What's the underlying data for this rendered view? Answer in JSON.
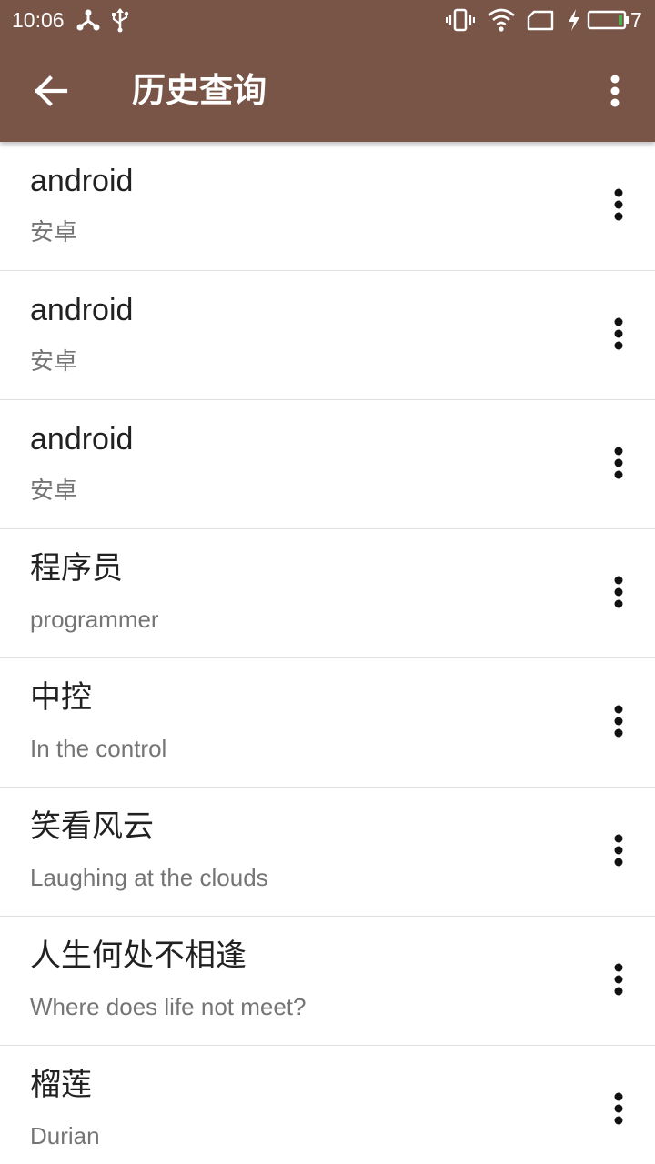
{
  "status_bar": {
    "time": "10:06",
    "battery_level": "7",
    "icons": [
      "share-network-icon",
      "usb-icon",
      "vibrate-icon",
      "wifi-icon",
      "sim-card-icon",
      "charging-bolt-icon",
      "battery-icon"
    ]
  },
  "toolbar": {
    "title": "历史查询",
    "back_icon": "arrow-back-icon",
    "menu_icon": "more-vert-icon"
  },
  "colors": {
    "app_bar": "#795548",
    "primary_text": "#212121",
    "secondary_text": "#757575",
    "divider": "#e0e0e0",
    "battery_fill": "#4caf50"
  },
  "history": [
    {
      "word": "android",
      "meaning": "安卓"
    },
    {
      "word": "android",
      "meaning": "安卓"
    },
    {
      "word": "android",
      "meaning": "安卓"
    },
    {
      "word": "程序员",
      "meaning": "programmer"
    },
    {
      "word": "中控",
      "meaning": "In the control"
    },
    {
      "word": "笑看风云",
      "meaning": "Laughing at the clouds"
    },
    {
      "word": "人生何处不相逢",
      "meaning": "Where does life not meet?"
    },
    {
      "word": "榴莲",
      "meaning": "Durian"
    }
  ]
}
